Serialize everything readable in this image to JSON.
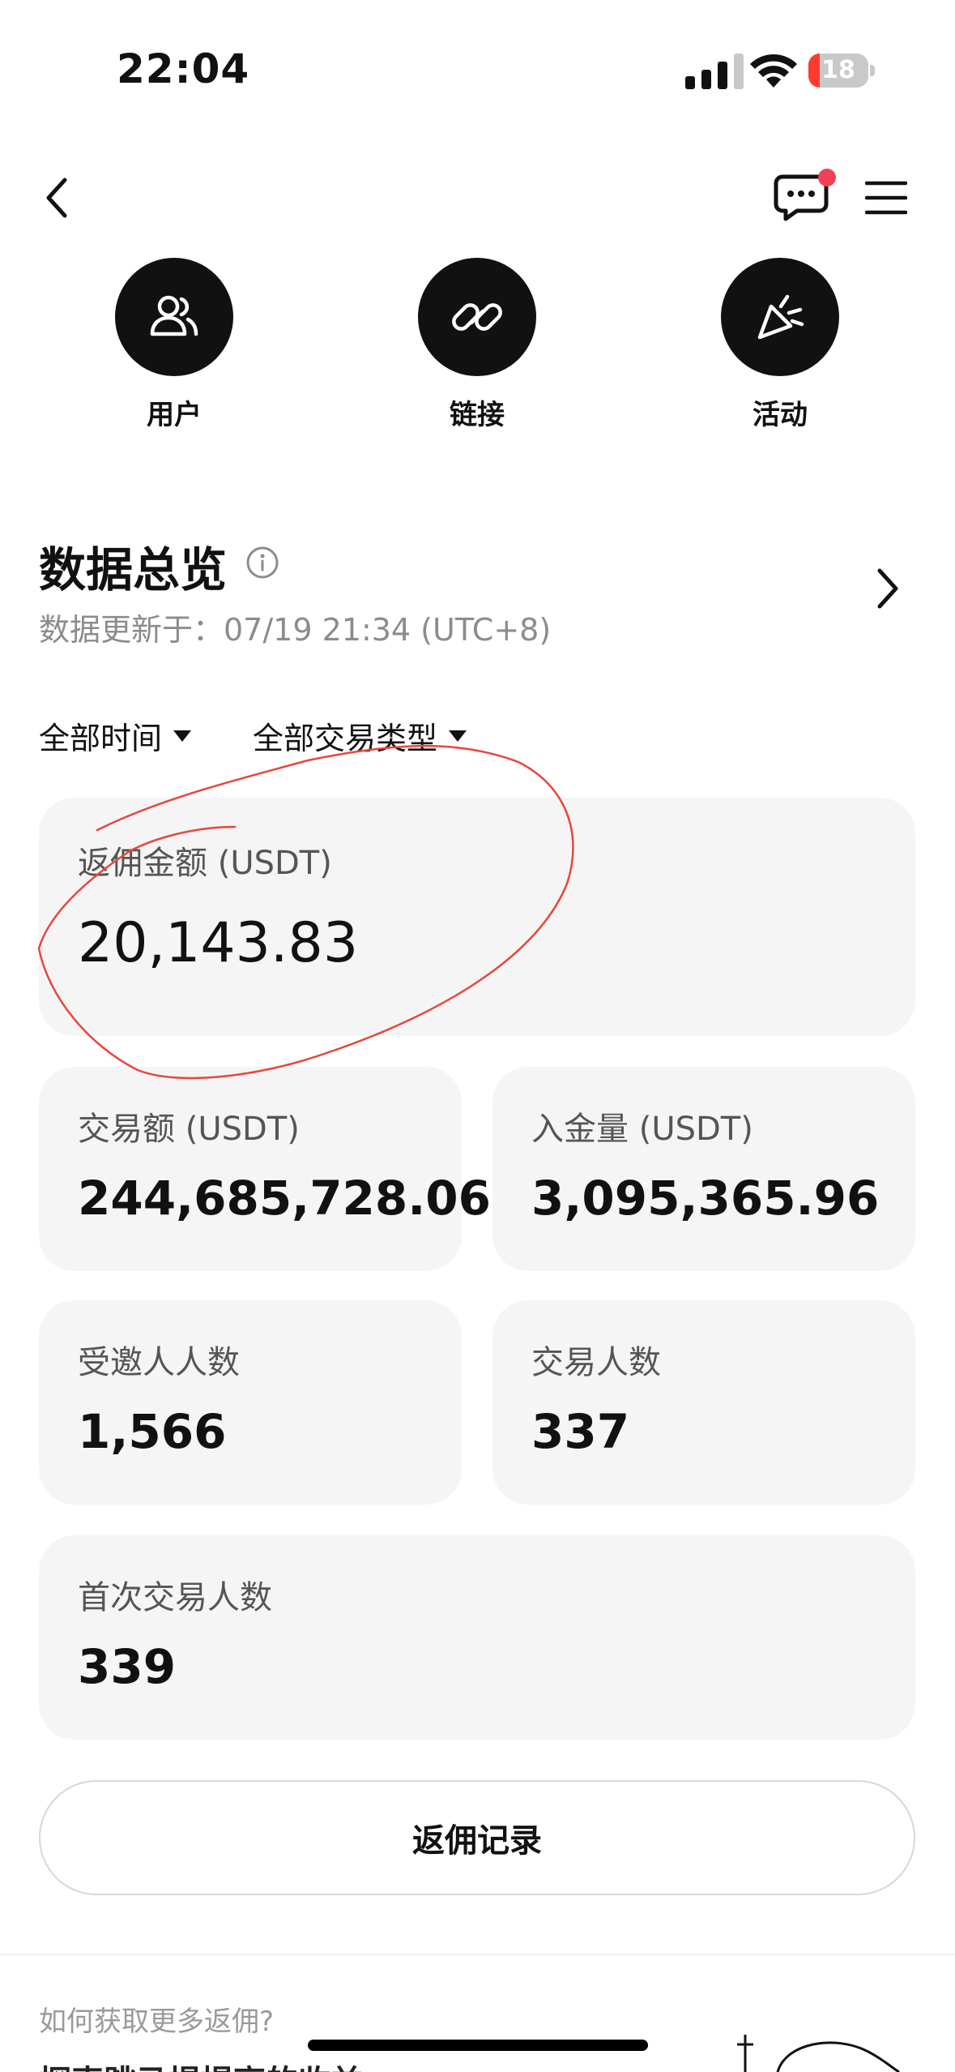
{
  "status_bar": {
    "time": "22:04",
    "battery": "18"
  },
  "quick_actions": [
    {
      "label": "用户"
    },
    {
      "label": "链接"
    },
    {
      "label": "活动"
    }
  ],
  "overview": {
    "title": "数据总览",
    "updated": "数据更新于：07/19 21:34 (UTC+8)"
  },
  "filters": {
    "time": "全部时间",
    "trade_type": "全部交易类型"
  },
  "stats": {
    "rebate": {
      "label": "返佣金额 (USDT)",
      "value": "20,143.83"
    },
    "volume": {
      "label": "交易额 (USDT)",
      "value": "244,685,728.06"
    },
    "deposit": {
      "label": "入金量 (USDT)",
      "value": "3,095,365.96"
    },
    "invited": {
      "label": "受邀人人数",
      "value": "1,566"
    },
    "traders": {
      "label": "交易人数",
      "value": "337"
    },
    "first_traders": {
      "label": "首次交易人数",
      "value": "339"
    }
  },
  "record_button": "返佣记录",
  "footer": {
    "question": "如何获取更多返佣?",
    "cut_title": "探索跳马提提高的收益"
  },
  "colors": {
    "card_bg": "#f5f5f5",
    "notification_dot": "#f0405a",
    "annotation": "#e8473a"
  }
}
